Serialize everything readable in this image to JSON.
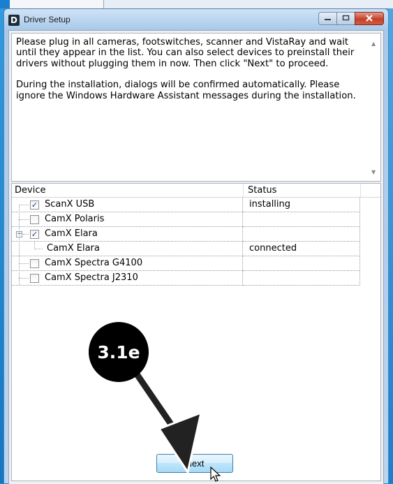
{
  "window": {
    "title": "Driver Setup",
    "icon_letter": "D",
    "caption_buttons": [
      "minimize-icon",
      "maximize-icon",
      "close-icon"
    ]
  },
  "info": {
    "paragraph1": "Please plug in all cameras, footswitches, scanner and VistaRay and wait until they appear in the list. You can also select devices to preinstall their drivers without plugging them in now. Then click \"Next\" to proceed.",
    "paragraph2": "During the installation, dialogs will be confirmed automatically. Please ignore the Windows Hardware Assistant messages during the installation."
  },
  "device_list": {
    "columns": [
      "Device",
      "Status"
    ],
    "rows": [
      {
        "device": "ScanX USB",
        "checked": true,
        "status": "installing"
      },
      {
        "device": "CamX Polaris",
        "checked": false,
        "status": ""
      },
      {
        "device": "CamX Elara",
        "checked": true,
        "status": "",
        "expanded": true
      },
      {
        "device": "CamX Elara",
        "child": true,
        "status": "connected"
      },
      {
        "device": "CamX Spectra G4100",
        "checked": false,
        "status": ""
      },
      {
        "device": "CamX Spectra J2310",
        "checked": false,
        "status": ""
      }
    ]
  },
  "buttons": {
    "next": "Next"
  },
  "annotation": {
    "step": "3.1e"
  },
  "colors": {
    "annotation": "#000000",
    "desktop_blue": "#1a8fd6",
    "button_border": "#3c7fb1"
  }
}
